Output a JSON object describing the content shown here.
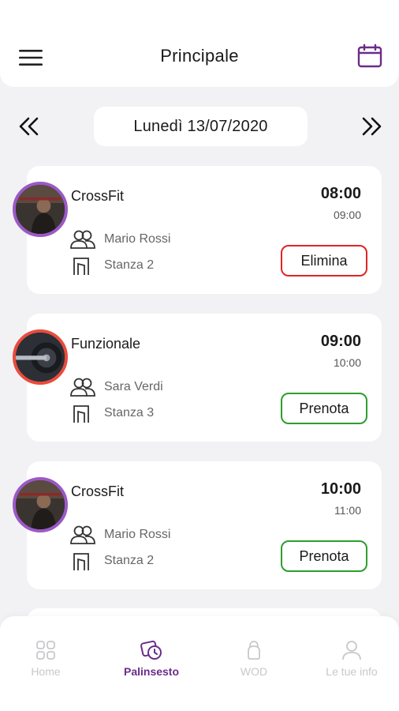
{
  "header": {
    "title": "Principale"
  },
  "date_nav": {
    "date": "Lunedì 13/07/2020"
  },
  "colors": {
    "accent": "#6a2c8a",
    "avatar_purple": "#9b59c6",
    "avatar_red": "#e84c3d",
    "delete": "#e02424",
    "book": "#2e9e2e",
    "tab_inactive": "#c8c8cc"
  },
  "sessions": [
    {
      "class": "CrossFit",
      "start": "08:00",
      "end": "09:00",
      "trainer": "Mario Rossi",
      "room": "Stanza 2",
      "action": "Elimina",
      "action_type": "delete",
      "avatar_border": "purple"
    },
    {
      "class": "Funzionale",
      "start": "09:00",
      "end": "10:00",
      "trainer": "Sara Verdi",
      "room": "Stanza 3",
      "action": "Prenota",
      "action_type": "book",
      "avatar_border": "red"
    },
    {
      "class": "CrossFit",
      "start": "10:00",
      "end": "11:00",
      "trainer": "Mario Rossi",
      "room": "Stanza 2",
      "action": "Prenota",
      "action_type": "book",
      "avatar_border": "purple"
    }
  ],
  "tabs": [
    {
      "label": "Home",
      "icon": "grid-icon",
      "active": false
    },
    {
      "label": "Palinsesto",
      "icon": "schedule-icon",
      "active": true
    },
    {
      "label": "WOD",
      "icon": "kettlebell-icon",
      "active": false
    },
    {
      "label": "Le tue info",
      "icon": "user-icon",
      "active": false
    }
  ]
}
